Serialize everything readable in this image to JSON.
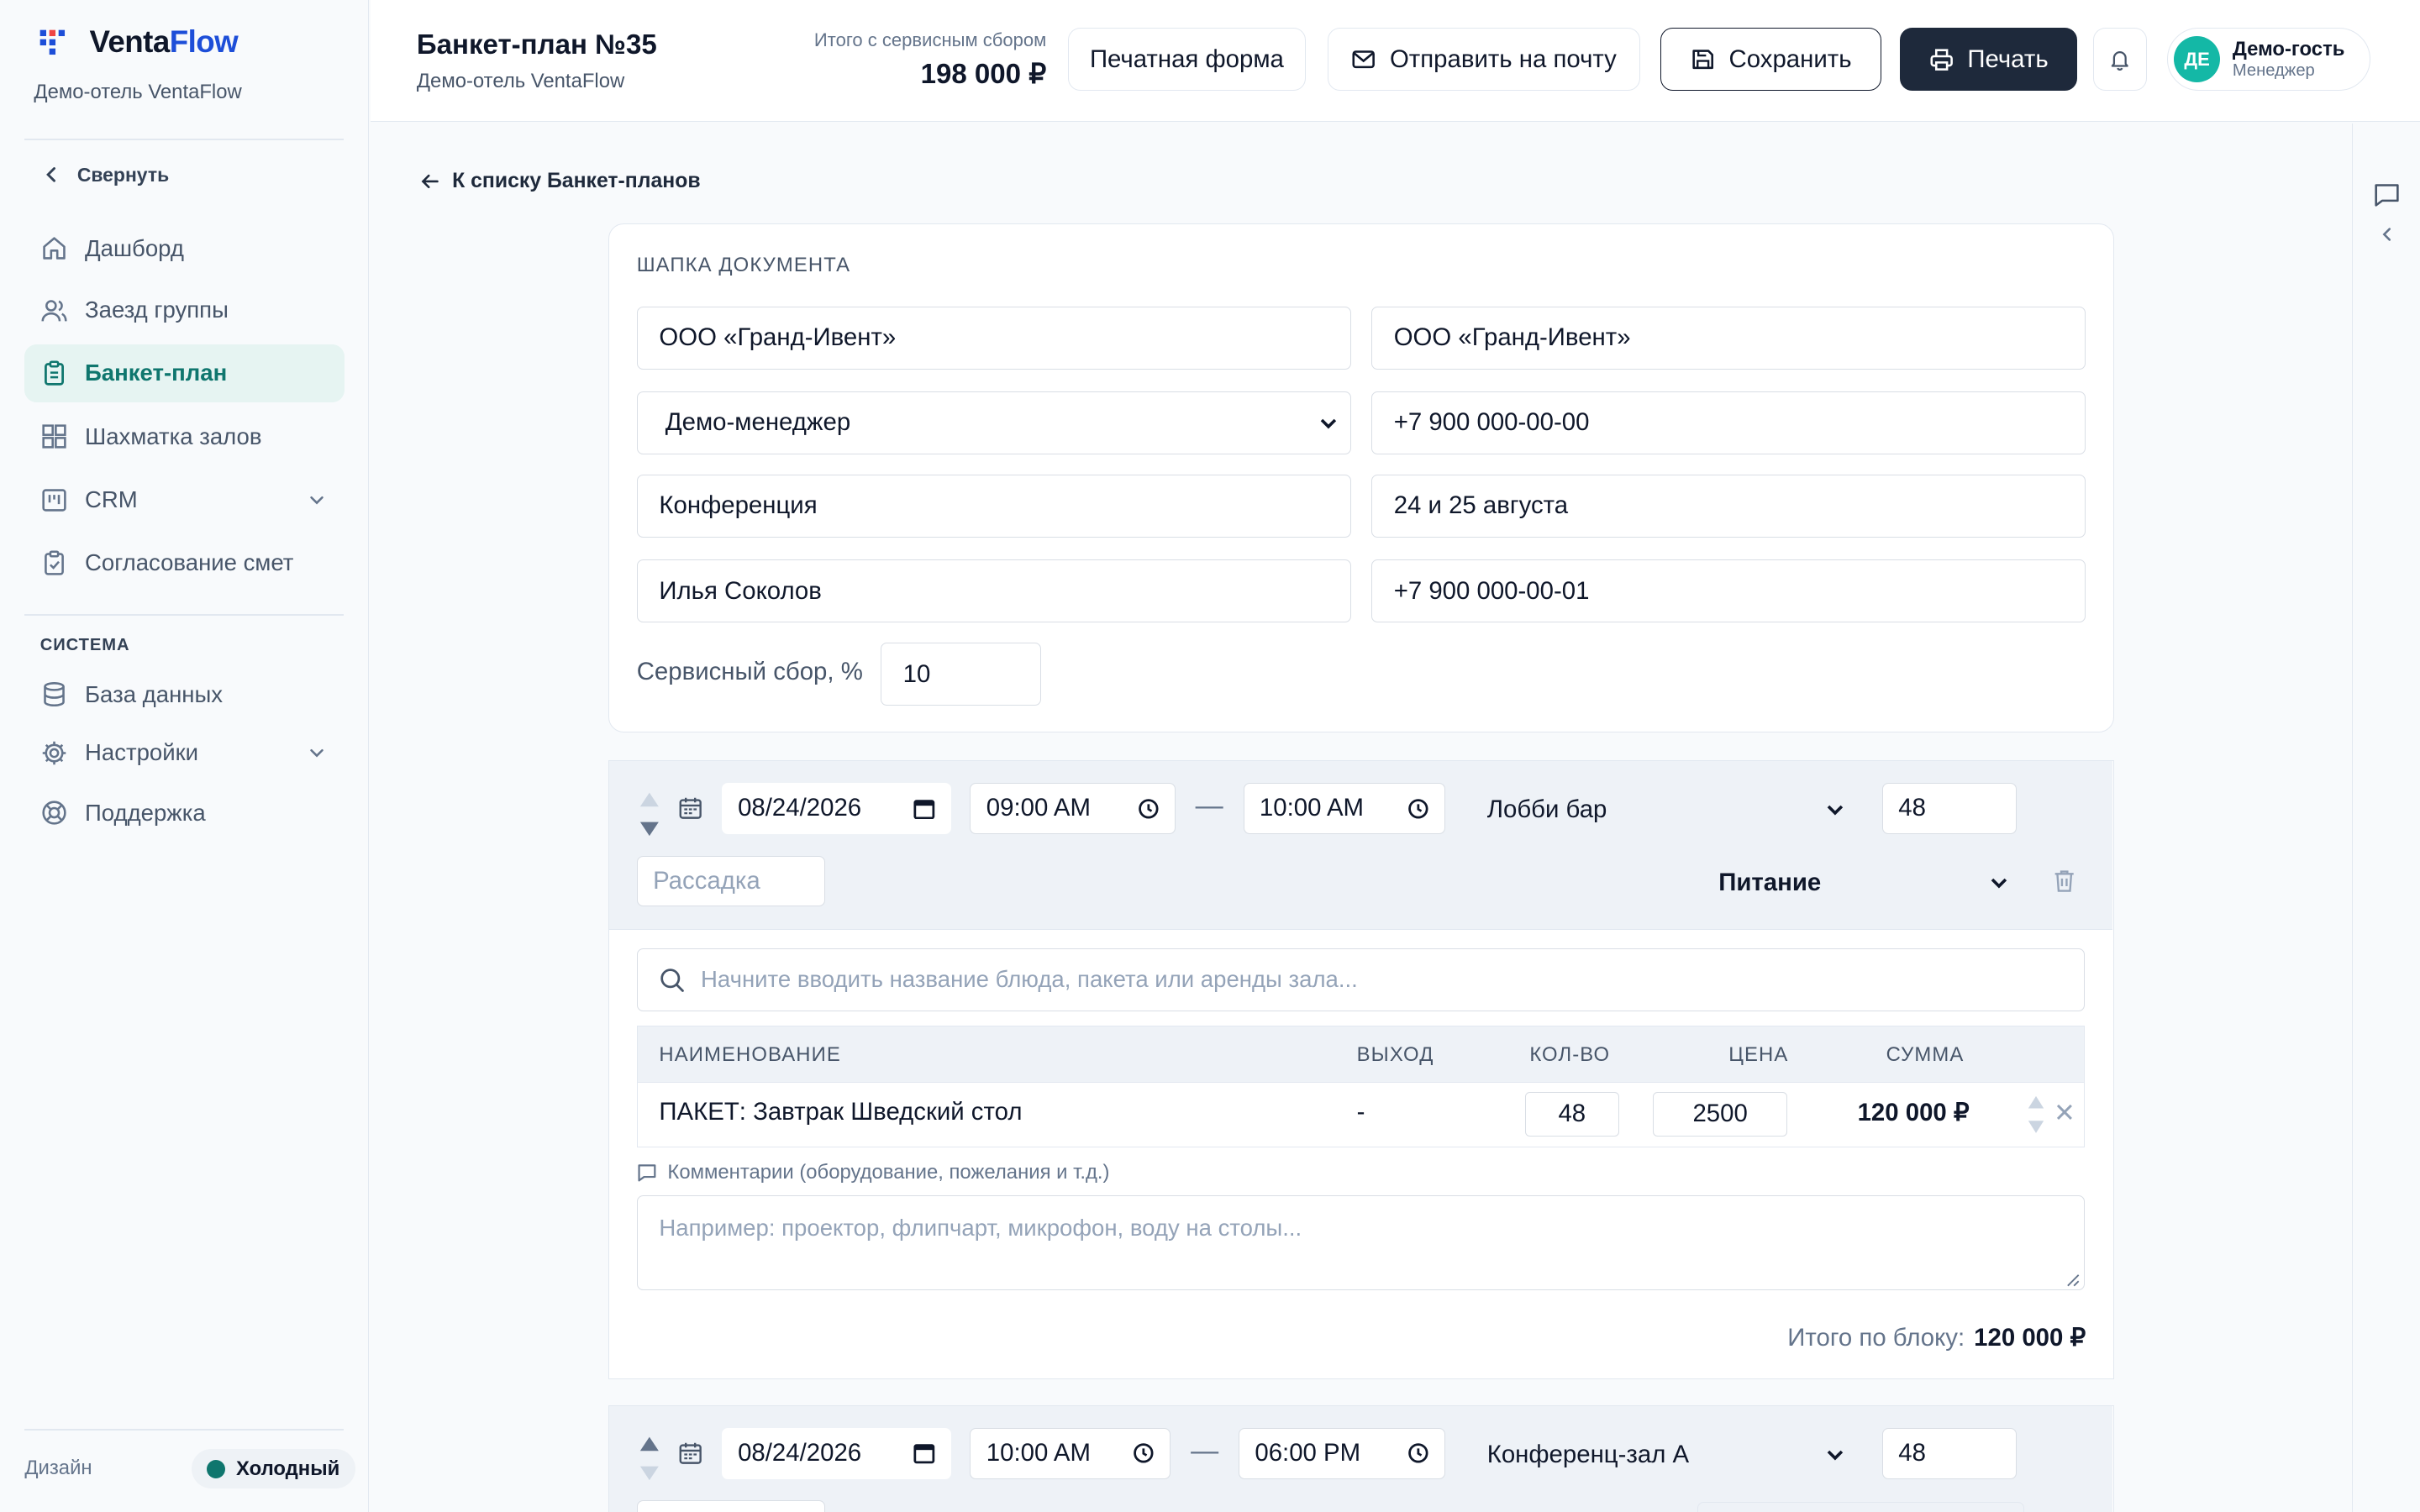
{
  "app": {
    "brand_part1": "Venta",
    "brand_part2": "Flow",
    "hotel": "Демо-отель VentaFlow"
  },
  "sidebar": {
    "collapse_label": "Свернуть",
    "items": [
      {
        "label": "Дашборд",
        "icon": "home-icon"
      },
      {
        "label": "Заезд группы",
        "icon": "users-icon"
      },
      {
        "label": "Банкет-план",
        "icon": "clipboard-icon",
        "active": true
      },
      {
        "label": "Шахматка залов",
        "icon": "grid-icon"
      },
      {
        "label": "CRM",
        "icon": "kanban-icon",
        "expandable": true
      },
      {
        "label": "Согласование смет",
        "icon": "clipboard-check-icon"
      }
    ],
    "system_label": "СИСТЕМА",
    "system_items": [
      {
        "label": "База данных",
        "icon": "database-icon"
      },
      {
        "label": "Настройки",
        "icon": "gear-icon",
        "expandable": true
      },
      {
        "label": "Поддержка",
        "icon": "lifebuoy-icon"
      }
    ],
    "design_label": "Дизайн",
    "theme_label": "Холодный",
    "theme_color": "#0f766e"
  },
  "header": {
    "title": "Банкет-план №35",
    "subtitle": "Демо-отель VentaFlow",
    "total_label": "Итого с сервисным сбором",
    "total_value": "198 000 ₽",
    "print_form": "Печатная форма",
    "send_email": "Отправить на почту",
    "save": "Сохранить",
    "print": "Печать",
    "user_initials": "ДЕ",
    "user_name": "Демо-гость",
    "user_role": "Менеджер"
  },
  "main": {
    "back_link": "К списку Банкет-планов",
    "doc_header": {
      "title": "ШАПКА ДОКУМЕНТА",
      "company_left": "ООО «Гранд-Ивент»",
      "company_right": "ООО «Гранд-Ивент»",
      "manager": "Демо-менеджер",
      "phone_1": "+7 900 000-00-00",
      "event_type": "Конференция",
      "dates": "24 и 25 августа",
      "contact": "Илья Соколов",
      "phone_2": "+7 900 000-00-01",
      "fee_label": "Сервисный сбор, %",
      "fee_value": "10"
    },
    "blocks": [
      {
        "date": "08/24/2026",
        "time_from": "09:00 AM",
        "time_to": "10:00 AM",
        "hall": "Лобби бар",
        "guests": "48",
        "seating_placeholder": "Рассадка",
        "category": "Питание",
        "search_placeholder": "Начните вводить название блюда, пакета или аренды зала...",
        "columns": {
          "name": "НАИМЕНОВАНИЕ",
          "output": "ВЫХОД",
          "qty": "КОЛ-ВО",
          "price": "ЦЕНА",
          "sum": "СУММА"
        },
        "rows": [
          {
            "name": "ПАКЕТ: Завтрак Шведский стол",
            "output": "-",
            "qty": "48",
            "price": "2500",
            "sum": "120 000 ₽"
          }
        ],
        "comments_label": "Комментарии (оборудование, пожелания и т.д.)",
        "comments_placeholder": "Например: проектор, флипчарт, микрофон, воду на столы...",
        "total_label": "Итого по блоку:",
        "total_value": "120 000 ₽"
      },
      {
        "date": "08/24/2026",
        "time_from": "10:00 AM",
        "time_to": "06:00 PM",
        "hall": "Конференц-зал А",
        "guests": "48"
      }
    ]
  }
}
